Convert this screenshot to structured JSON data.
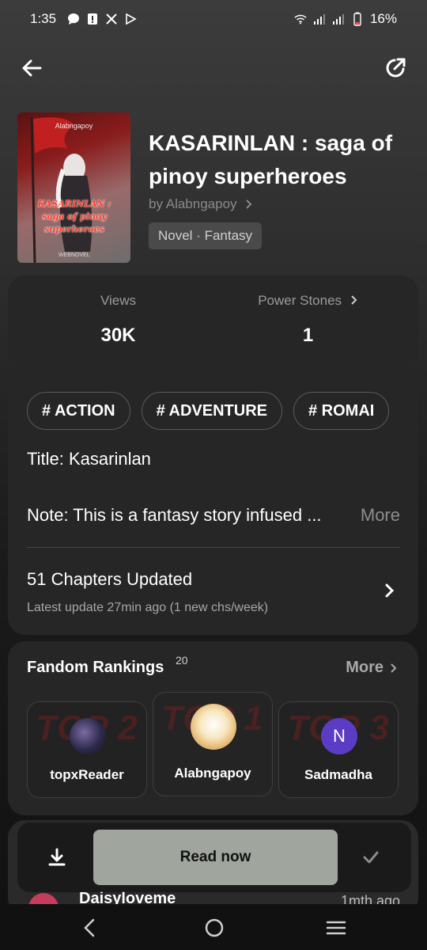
{
  "status_bar": {
    "time": "1:35",
    "battery": "16%",
    "icons": [
      "message-icon",
      "alert-icon",
      "x-icon",
      "play-icon",
      "wifi-icon",
      "signal-icon",
      "signal-icon",
      "battery-icon"
    ]
  },
  "book": {
    "title": "KASARINLAN : saga of pinoy superheroes",
    "author": "by Alabngapoy",
    "genre": "Novel · Fantasy",
    "cover": {
      "author_text": "Alabngapoy",
      "title_text": "KASARINLAN : saga of pinoy superheroes",
      "brand_text": "WEBNOVEL"
    }
  },
  "stats": {
    "views_label": "Views",
    "views_value": "30K",
    "power_label": "Power Stones",
    "power_value": "1"
  },
  "info": {
    "tags": [
      "# ACTION",
      "# ADVENTURE",
      "# ROMAI"
    ],
    "title_line": "Title: Kasarinlan",
    "note": "Note: This is a fantasy story infused ...",
    "note_more": "More",
    "chapters": "51 Chapters Updated",
    "latest": "Latest update 27min ago (1 new chs/week)"
  },
  "fandom": {
    "title": "Fandom Rankings",
    "count": "20",
    "more": "More",
    "rankings": [
      {
        "badge": "TOP 2",
        "name": "topxReader"
      },
      {
        "badge": "TOP 1",
        "name": "Alabngapoy"
      },
      {
        "badge": "TOP 3",
        "name": "Sadmadha",
        "initial": "N"
      }
    ]
  },
  "bottom": {
    "read_label": "Read now",
    "peek_name": "Daisyloveme",
    "peek_time": "1mth ago"
  },
  "colors": {
    "accent_avatar": "#5b3cc4",
    "read_button": "#a0a59e",
    "card_bg": "#262626"
  }
}
